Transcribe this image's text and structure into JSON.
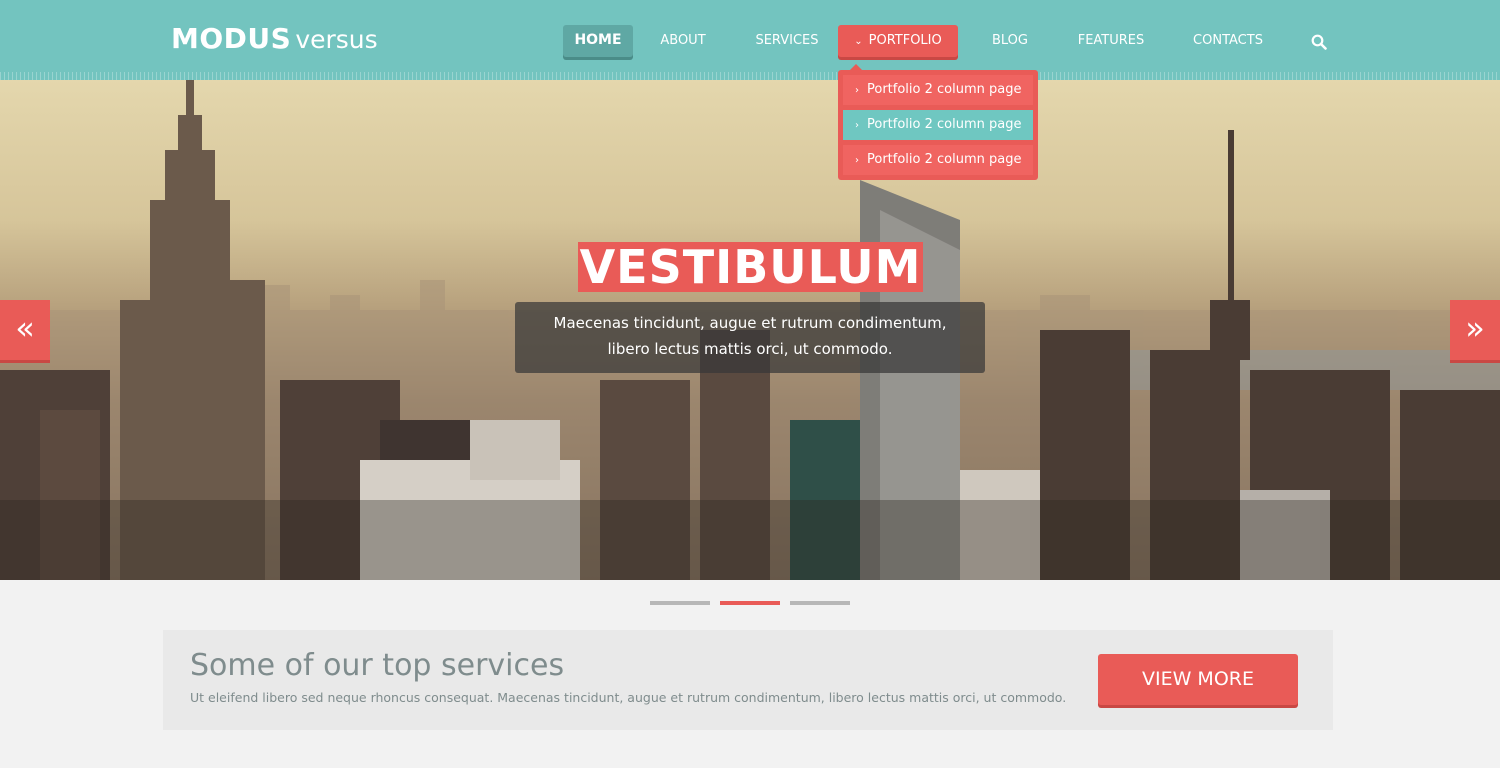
{
  "logo": {
    "bold": "MODUS",
    "light": "versus"
  },
  "nav": {
    "home": "HOME",
    "about": "ABOUT",
    "services": "SERVICES",
    "portfolio": "PORTFOLIO",
    "blog": "BLOG",
    "features": "FEATURES",
    "contacts": "CONTACTS",
    "search_icon": "search-icon"
  },
  "dropdown": {
    "items": [
      {
        "label": "Portfolio 2 column page"
      },
      {
        "label": "Portfolio 2 column page"
      },
      {
        "label": "Portfolio 2 column page"
      }
    ]
  },
  "hero": {
    "title": "VESTIBULUM",
    "caption_line1": "Maecenas tincidunt, augue et rutrum condimentum,",
    "caption_line2": "libero lectus mattis orci, ut commodo.",
    "prev_icon": "«",
    "next_icon": "»"
  },
  "slider": {
    "active_index": 1,
    "count": 3
  },
  "services": {
    "title": "Some of our top services",
    "text": "Ut eleifend libero sed neque rhoncus consequat. Maecenas tincidunt, augue et rutrum condimentum, libero lectus mattis orci, ut commodo.",
    "button": "VIEW MORE"
  },
  "colors": {
    "teal": "#73c4bf",
    "coral": "#e95b57",
    "teal_dark": "#5fa8a4"
  }
}
